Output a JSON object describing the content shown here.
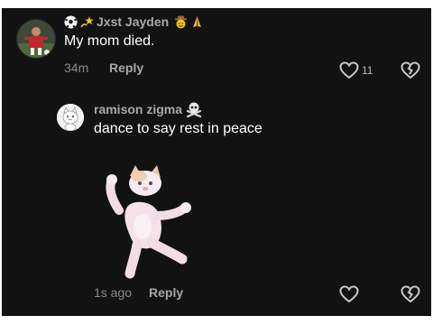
{
  "comment": {
    "username": "Jxst Jayden",
    "text": "My mom died.",
    "time": "34m",
    "reply_label": "Reply",
    "like_count": "11",
    "avatar_icon": "soccer-player-avatar",
    "badges": [
      "soccer-ball-emoji",
      "dizzy-emoji"
    ],
    "suffix_emojis": [
      "cowboy-face-emoji",
      "folded-hands-emoji"
    ]
  },
  "reply": {
    "username": "ramison zigma",
    "username_emoji": "skull-crossbones-emoji",
    "text": "dance to say rest in peace",
    "sticker": "dancing-cat-sticker",
    "time": "1s ago",
    "reply_label": "Reply",
    "avatar_icon": "white-cat-avatar"
  },
  "colors": {
    "background": "#121212",
    "primary_text": "#ffffff",
    "secondary_text": "#a9a9a9",
    "meta_text": "#8a8a8a",
    "icon": "#c8c8c8"
  }
}
